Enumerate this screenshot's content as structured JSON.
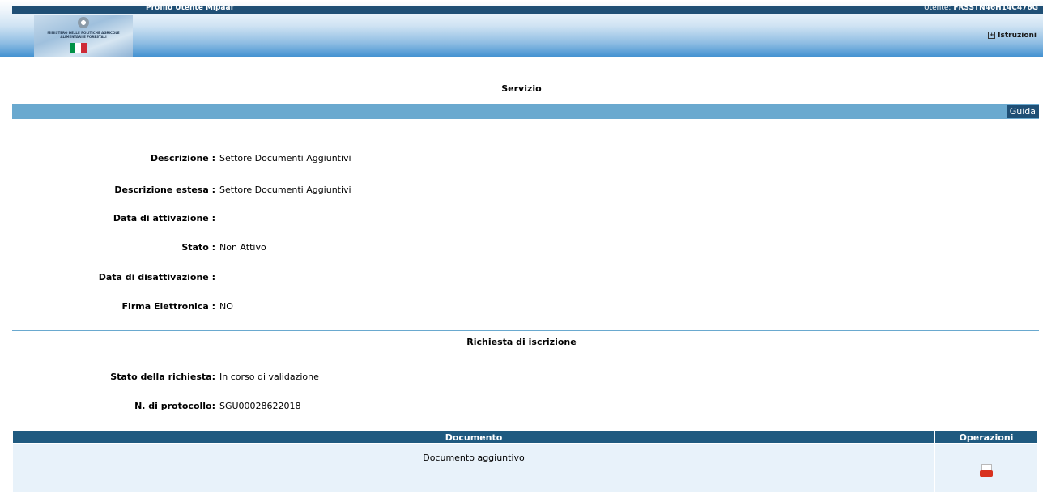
{
  "header": {
    "profile_title": "Profilo Utente Mipaaf",
    "user_label": "Utente:",
    "user_code": "FRSSTN46H14C476G",
    "logo_text": "MINISTERO DELLE POLITICHE AGRICOLE ALIMENTARI E FORESTALI",
    "instructions_label": "Istruzioni",
    "flag_colors": [
      "#009246",
      "#ffffff",
      "#ce2b37"
    ]
  },
  "page": {
    "title": "Servizio",
    "guide_button": "Guida"
  },
  "service": {
    "fields": [
      {
        "label": "Descrizione :",
        "value": "Settore Documenti Aggiuntivi"
      },
      {
        "label": "Descrizione estesa :",
        "value": "Settore Documenti Aggiuntivi"
      },
      {
        "label": "Data di attivazione :",
        "value": ""
      },
      {
        "label": "Stato :",
        "value": "Non Attivo"
      },
      {
        "label": "Data di disattivazione :",
        "value": ""
      },
      {
        "label": "Firma Elettronica :",
        "value": "NO"
      }
    ]
  },
  "request": {
    "title": "Richiesta di iscrizione",
    "fields": [
      {
        "label": "Stato della richiesta:",
        "value": "In corso di validazione"
      },
      {
        "label": "N. di protocollo:",
        "value": "SGU00028622018"
      }
    ]
  },
  "documents_table": {
    "headers": [
      "Documento",
      "Operazioni"
    ],
    "rows": [
      {
        "documento": "Documento aggiuntivo",
        "operazione_icon": "pdf-icon"
      }
    ]
  },
  "colors": {
    "dark_blue": "#1f4f75",
    "bar_blue": "#6aa9cf",
    "row_bg": "#e8f2fa"
  }
}
